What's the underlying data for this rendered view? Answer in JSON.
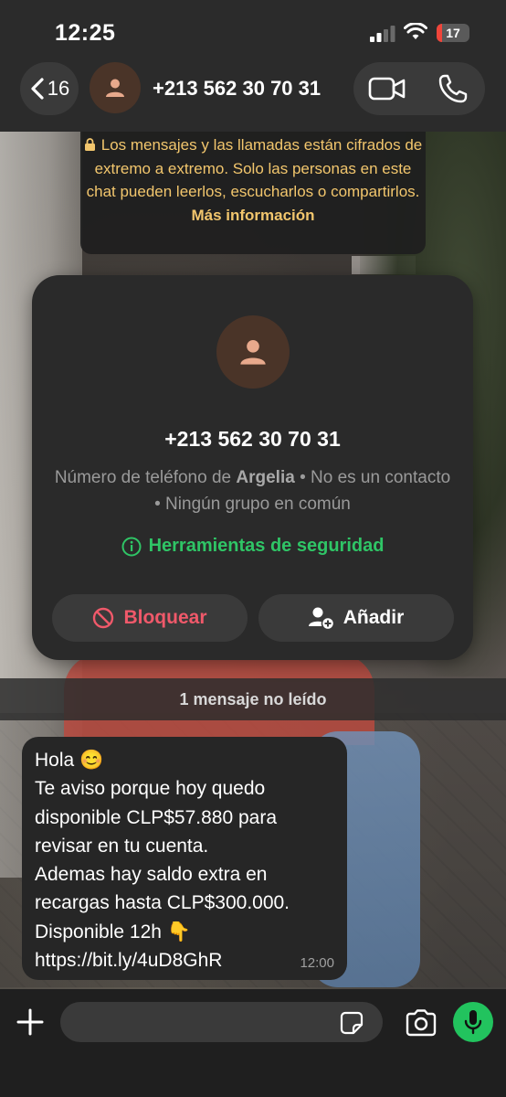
{
  "status_bar": {
    "time": "12:25",
    "battery_level": "17",
    "battery_fraction": 0.17,
    "signal_bars_active": 2,
    "signal_bars_total": 4
  },
  "header": {
    "back_count": "16",
    "title": "+213 562 30 70 31"
  },
  "encryption_notice": {
    "text": "Los mensajes y las llamadas están cifrados de extremo a extremo. Solo las personas en este chat pueden leerlos, escucharlos o compartirlos.",
    "link": "Más información"
  },
  "contact_card": {
    "number": "+213 562 30 70 31",
    "info_prefix": "Número de teléfono de ",
    "country": "Argelia",
    "info_suffix": " • No es un contacto • Ningún grupo en común",
    "safety_tools": "Herramientas de seguridad",
    "block_label": "Bloquear",
    "add_label": "Añadir"
  },
  "unread_divider": "1 mensaje no leído",
  "message": {
    "text": "Hola 😊\nTe aviso porque hoy quedo disponible CLP$57.880 para revisar en tu cuenta.\nAdemas hay saldo extra en recargas hasta CLP$300.000.\nDisponible 12h 👇\nhttps://bit.ly/4uD8GhR",
    "time": "12:00"
  },
  "composer": {
    "placeholder": ""
  },
  "colors": {
    "safety_green": "#2fc566",
    "block_red": "#f0596a",
    "encryption_yellow": "#f2c66d",
    "mic_green": "#22c35e",
    "battery_red": "#f0453a"
  },
  "icons": [
    "chevron-left-icon",
    "person-icon",
    "video-icon",
    "phone-icon",
    "lock-icon",
    "info-icon",
    "block-icon",
    "add-person-icon",
    "plus-icon",
    "sticker-icon",
    "camera-icon",
    "mic-icon",
    "signal-icon",
    "wifi-icon",
    "battery-icon"
  ]
}
